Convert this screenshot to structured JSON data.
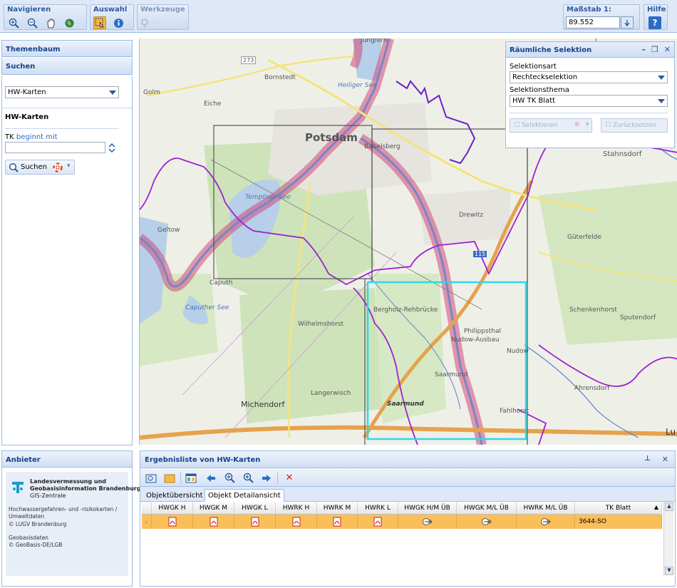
{
  "toolbar": {
    "navigieren": {
      "label": "Navigieren",
      "tools": [
        "zoom-in-icon",
        "zoom-out-icon",
        "pan-hand-icon",
        "globe-icon"
      ]
    },
    "auswahl": {
      "label": "Auswahl",
      "tools": [
        "select-rectangle-icon",
        "info-icon"
      ]
    },
    "werkzeuge": {
      "label": "Werkzeuge"
    },
    "massstab": {
      "label": "Maßstab 1:",
      "value": "89.552"
    },
    "hilfe": {
      "label": "Hilfe",
      "button": "?"
    }
  },
  "left": {
    "themenbaum": "Themenbaum",
    "suchen": "Suchen",
    "layer_select": "HW-Karten",
    "section_title": "HW-Karten",
    "tk_label": "TK",
    "tk_hint": "beginnt mit",
    "tk_value": "",
    "search_button": "Suchen"
  },
  "selection": {
    "title": "Räumliche Selektion",
    "art_label": "Selektionsart",
    "art_value": "Rechteckselektion",
    "thema_label": "Selektionsthema",
    "thema_value": "HW TK Blatt",
    "btn_select": "Selektieren",
    "btn_reset": "Zurücksetzen"
  },
  "map": {
    "labels": {
      "potsdam": "Potsdam",
      "babelsberg": "Babelsberg",
      "bornstedt": "Bornstedt",
      "golm": "Golm",
      "eiche": "Eiche",
      "jungfern": "Jungfern",
      "heiliger_see": "Heiliger See",
      "stahnsdorf": "Stahnsdorf",
      "drewitz": "Drewitz",
      "templiner_see": "Templiner See",
      "geltow": "Geltow",
      "caputh": "Caputh",
      "caputher_see": "Caputher See",
      "guterfelde": "Güterfelde",
      "bergholz": "Bergholz-Rehbrücke",
      "wilhelmshorst": "Wilhelmshorst",
      "schenkenhorst": "Schenkenhorst",
      "sputendorf": "Sputendorf",
      "philippsthal": "Philippsthal",
      "nudow_ausbau": "Nudow-Ausbau",
      "nudow": "Nudow",
      "saarmund": "Saarmund",
      "saarmund_bold": "Saarmund",
      "langerwisch": "Langerwisch",
      "michendorf": "Michendorf",
      "ahrensdorf": "Ahrensdorf",
      "fahlhorst": "Fahlhorst",
      "road_273": "273",
      "road_115": "115",
      "lu": "Lu"
    }
  },
  "provider": {
    "title": "Anbieter",
    "org_line1": "Landesvermessung und",
    "org_line2": "Geobasisinformation Brandenburg",
    "org_line3": "GIS-Zentrale",
    "text1": "Hochwassergefahren- und -risikokarten / Umweltdaten",
    "text2": "© LUGV Brandenburg",
    "text3": "Geobasisdaten",
    "text4": "© GeoBasis-DE/LGB"
  },
  "results": {
    "title": "Ergebnisliste von HW-Karten",
    "tabs": [
      "Objektübersicht",
      "Objekt Detailansicht"
    ],
    "columns": [
      "HWGK H",
      "HWGK M",
      "HWGK L",
      "HWRK H",
      "HWRK M",
      "HWRK L",
      "HWGK H/M ÜB",
      "HWGK M/L ÜB",
      "HWRK M/L ÜB",
      "TK Blatt"
    ],
    "row": {
      "tk_blatt": "3644-SO"
    }
  },
  "colors": {
    "panel_header": "#cfdef4",
    "border": "#99bbe8",
    "selected_row": "#fbbf5a",
    "selection_rect": "#2fd8e6",
    "boundary": "#a020d0",
    "river": "#d24a7a"
  }
}
